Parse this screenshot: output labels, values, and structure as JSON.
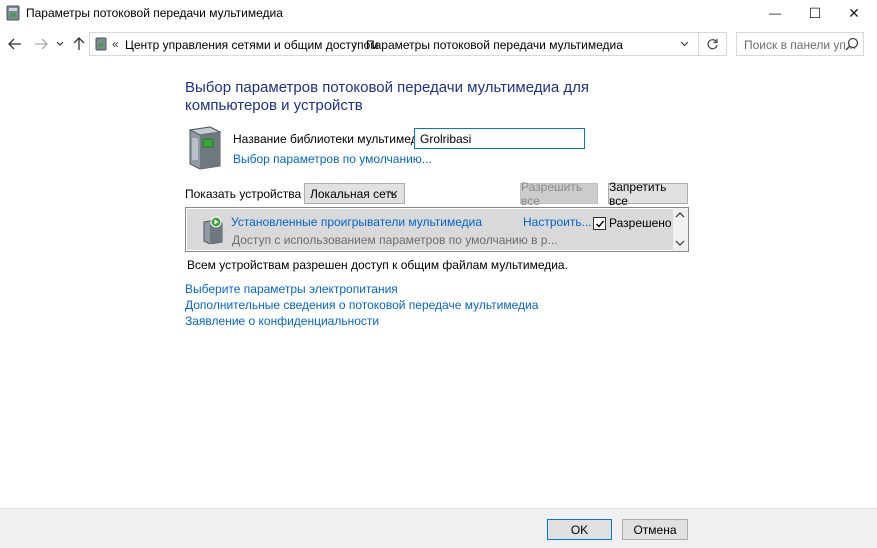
{
  "window": {
    "title": "Параметры потоковой передачи мультимедиа",
    "minimize_glyph": "—",
    "maximize_glyph": "☐",
    "close_glyph": "✕"
  },
  "nav": {
    "back_icon": "arrow-left-icon",
    "forward_icon": "arrow-right-icon",
    "recent_icon": "chevron-down-icon",
    "up_icon": "arrow-up-icon",
    "breadcrumb_root": "Центр управления сетями и общим доступом",
    "breadcrumb_current": "Параметры потоковой передачи мультимедиа",
    "search_placeholder": "Поиск в панели уп..."
  },
  "main": {
    "heading": "Выбор параметров потоковой передачи мультимедиа для компьютеров и устройств",
    "library_label": "Название библиотеки мультимедиа:",
    "library_value": "Grolribasi",
    "defaults_link": "Выбор параметров по умолчанию...",
    "show_devices_label": "Показать устройства на:",
    "show_devices_value": "Локальная сеть",
    "allow_all": "Разрешить все",
    "block_all": "Запретить все",
    "device": {
      "name": "Установленные проигрыватели мультимедиа",
      "desc": "Доступ с использованием параметров по умолчанию в р...",
      "configure": "Настроить...",
      "allowed_label": "Разрешено",
      "allowed": true
    },
    "status": "Всем устройствам разрешен доступ к общим файлам мультимедиа.",
    "links": [
      "Выберите параметры электропитания",
      "Дополнительные сведения о потоковой передаче мультимедиа",
      "Заявление о конфиденциальности"
    ]
  },
  "footer": {
    "ok": "OK",
    "cancel": "Отмена"
  },
  "colors": {
    "heading": "#1e3287",
    "link": "#0066cc",
    "focus": "#0078d7"
  }
}
